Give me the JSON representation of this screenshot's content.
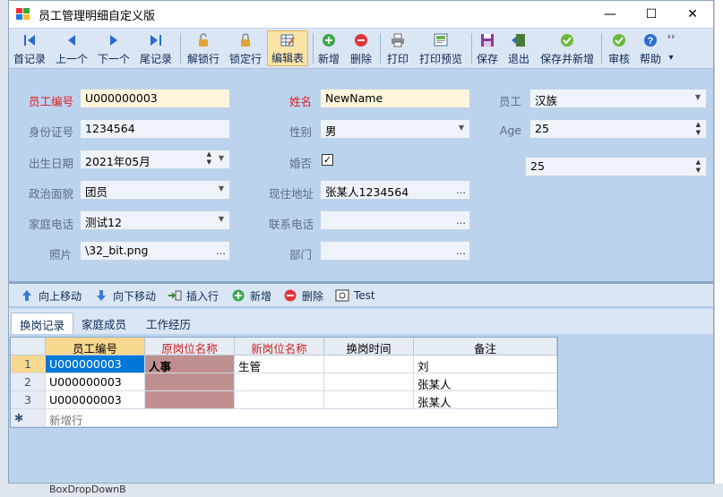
{
  "window": {
    "title": "员工管理明细自定义版",
    "minimize": "—",
    "maximize": "☐",
    "close": "✕"
  },
  "toolbar": {
    "first": "首记录",
    "prev": "上一个",
    "next": "下一个",
    "last": "尾记录",
    "unlock": "解锁行",
    "lock": "锁定行",
    "edit_table": "编辑表",
    "add": "新增",
    "delete": "删除",
    "print": "打印",
    "print_preview": "打印预览",
    "save": "保存",
    "exit": "退出",
    "save_and_new": "保存并新增",
    "audit": "审核",
    "help": "帮助",
    "overflow": "››",
    "more": "▾"
  },
  "form": {
    "emp_no_label": "员工编号",
    "emp_no": "U000000003",
    "name_label": "姓名",
    "name": "NewName",
    "staff_label": "员工",
    "staff": "汉族",
    "id_label": "身份证号",
    "id": "1234564",
    "gender_label": "性别",
    "gender": "男",
    "age_label": "Age",
    "age": "25",
    "birth_label": "出生日期",
    "birth": "2021年05月",
    "married_label": "婚否",
    "married_check": "✓",
    "age2": "25",
    "politics_label": "政治面貌",
    "politics": "团员",
    "address_label": "现住地址",
    "address": "张某人1234564",
    "phone_label": "家庭电话",
    "phone": "测试12",
    "contact_label": "联系电话",
    "contact": "",
    "photo_label": "照片",
    "photo": "\\32_bit.png",
    "dept_label": "部门",
    "dept": ""
  },
  "subtoolbar": {
    "up": "向上移动",
    "down": "向下移动",
    "insert": "插入行",
    "add": "新增",
    "delete": "删除",
    "test": "Test"
  },
  "tabs": [
    "换岗记录",
    "家庭成员",
    "工作经历"
  ],
  "grid": {
    "columns": [
      "员工编号",
      "原岗位名称",
      "新岗位名称",
      "换岗时间",
      "备注"
    ],
    "rows": [
      {
        "num": "1",
        "emp": "U000000003",
        "old": "人事",
        "new": "生管",
        "time": "",
        "note": "刘"
      },
      {
        "num": "2",
        "emp": "U000000003",
        "old": "",
        "new": "",
        "time": "",
        "note": "张某人"
      },
      {
        "num": "3",
        "emp": "U000000003",
        "old": "",
        "new": "",
        "time": "",
        "note": "张某人"
      }
    ],
    "new_row_marker": "✱",
    "new_row_label": "新增行"
  },
  "background": {
    "bottom_label": "BoxDropDownB"
  }
}
